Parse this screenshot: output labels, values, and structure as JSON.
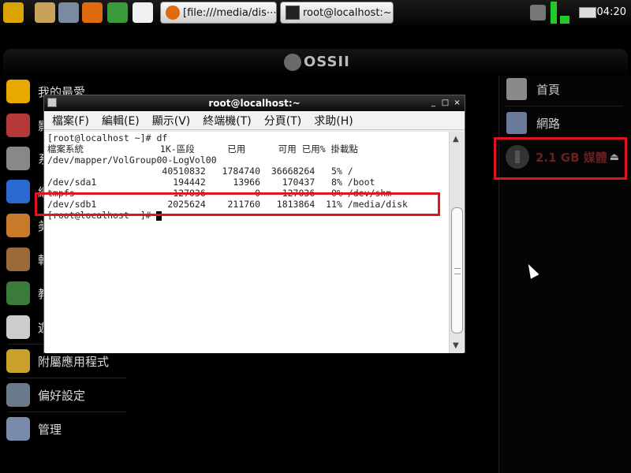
{
  "taskbar": {
    "launchers": [
      {
        "icon": "tux-menu-icon",
        "color": "#d9a400"
      },
      {
        "icon": "file-manager-icon",
        "color": "#c8a25a"
      },
      {
        "icon": "monitor-icon",
        "color": "#7a8aa0"
      },
      {
        "icon": "firefox-icon",
        "color": "#e06a10"
      },
      {
        "icon": "switch-window-icon",
        "color": "#3a9a3a"
      },
      {
        "icon": "tux-icon",
        "color": "#f0f0f0"
      }
    ],
    "tasks": [
      {
        "label": "[file:///media/dis⋯",
        "icon": "firefox-icon"
      },
      {
        "label": "root@localhost:~",
        "icon": "terminal-icon"
      }
    ],
    "clock": "04:20"
  },
  "desktop": {
    "brand": "OSSII",
    "left_menu": [
      {
        "label": "我的最愛",
        "icon": "star-icon",
        "color": "#e8a800"
      },
      {
        "label": "影",
        "icon": "film-icon",
        "color": "#b43a3a"
      },
      {
        "label": "系",
        "icon": "gear-icon",
        "color": "#888888"
      },
      {
        "label": "網",
        "icon": "globe-icon",
        "color": "#2a6ad0"
      },
      {
        "label": "美",
        "icon": "palette-icon",
        "color": "#c87a2a"
      },
      {
        "label": "軟",
        "icon": "hammer-icon",
        "color": "#9a6a3a"
      },
      {
        "label": "教",
        "icon": "books-icon",
        "color": "#3a7a3a"
      },
      {
        "label": "遊",
        "icon": "cards-icon",
        "color": "#cccccc"
      },
      {
        "label": "附屬應用程式",
        "icon": "tools-icon",
        "color": "#c8a02a"
      },
      {
        "label": "偏好設定",
        "icon": "preferences-icon",
        "color": "#6a7a8a"
      },
      {
        "label": "管理",
        "icon": "admin-icon",
        "color": "#7a8aaa"
      }
    ],
    "right_panel": {
      "items": [
        {
          "label": "首頁",
          "icon": "home-folder-icon",
          "color": "#8a8a8a"
        },
        {
          "label": "網路",
          "icon": "network-icon",
          "color": "#6a7a9a"
        }
      ],
      "media": {
        "label": "2.1 GB 媒體",
        "icon": "usb-drive-icon",
        "eject": "⏏"
      }
    }
  },
  "terminal": {
    "title": "root@localhost:~",
    "menu": [
      "檔案(F)",
      "編輯(E)",
      "顯示(V)",
      "終端機(T)",
      "分頁(T)",
      "求助(H)"
    ],
    "lines": [
      "[root@localhost ~]# df",
      "檔案系統              1K-區段      已用      可用 已用% 掛載點",
      "/dev/mapper/VolGroup00-LogVol00",
      "                     40510832   1784740  36668264   5% /",
      "/dev/sda1              194442     13966    170437   8% /boot",
      "tmpfs                  127036         0    127036   0% /dev/shm",
      "/dev/sdb1             2025624    211760   1813864  11% /media/disk",
      "[root@localhost ~]# "
    ]
  }
}
